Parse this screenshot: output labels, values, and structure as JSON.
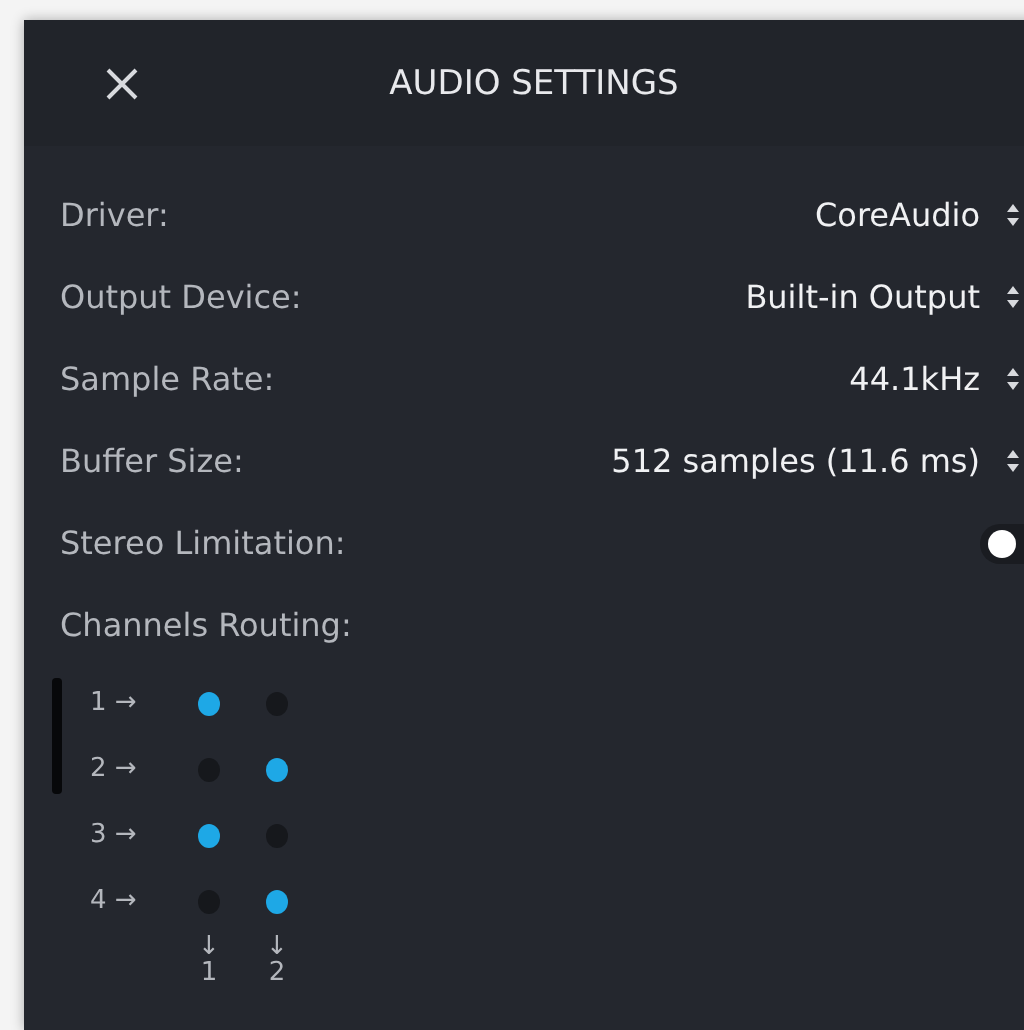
{
  "window": {
    "title": "AUDIO SETTINGS"
  },
  "settings": [
    {
      "kind": "select",
      "label": "Driver:",
      "value": "CoreAudio"
    },
    {
      "kind": "select",
      "label": "Output Device:",
      "value": "Built-in Output"
    },
    {
      "kind": "select",
      "label": "Sample Rate:",
      "value": "44.1kHz"
    },
    {
      "kind": "select",
      "label": "Buffer Size:",
      "value": "512 samples (11.6 ms)"
    },
    {
      "kind": "toggle",
      "label": "Stereo Limitation:",
      "on": false
    }
  ],
  "routing": {
    "label": "Channels Routing:",
    "inputs": [
      {
        "label": "1 →",
        "routes": [
          true,
          false
        ]
      },
      {
        "label": "2 →",
        "routes": [
          false,
          true
        ]
      },
      {
        "label": "3 →",
        "routes": [
          true,
          false
        ]
      },
      {
        "label": "4 →",
        "routes": [
          false,
          true
        ]
      }
    ],
    "outputs": [
      {
        "arrow": "↓",
        "label": "1"
      },
      {
        "arrow": "↓",
        "label": "2"
      }
    ]
  }
}
